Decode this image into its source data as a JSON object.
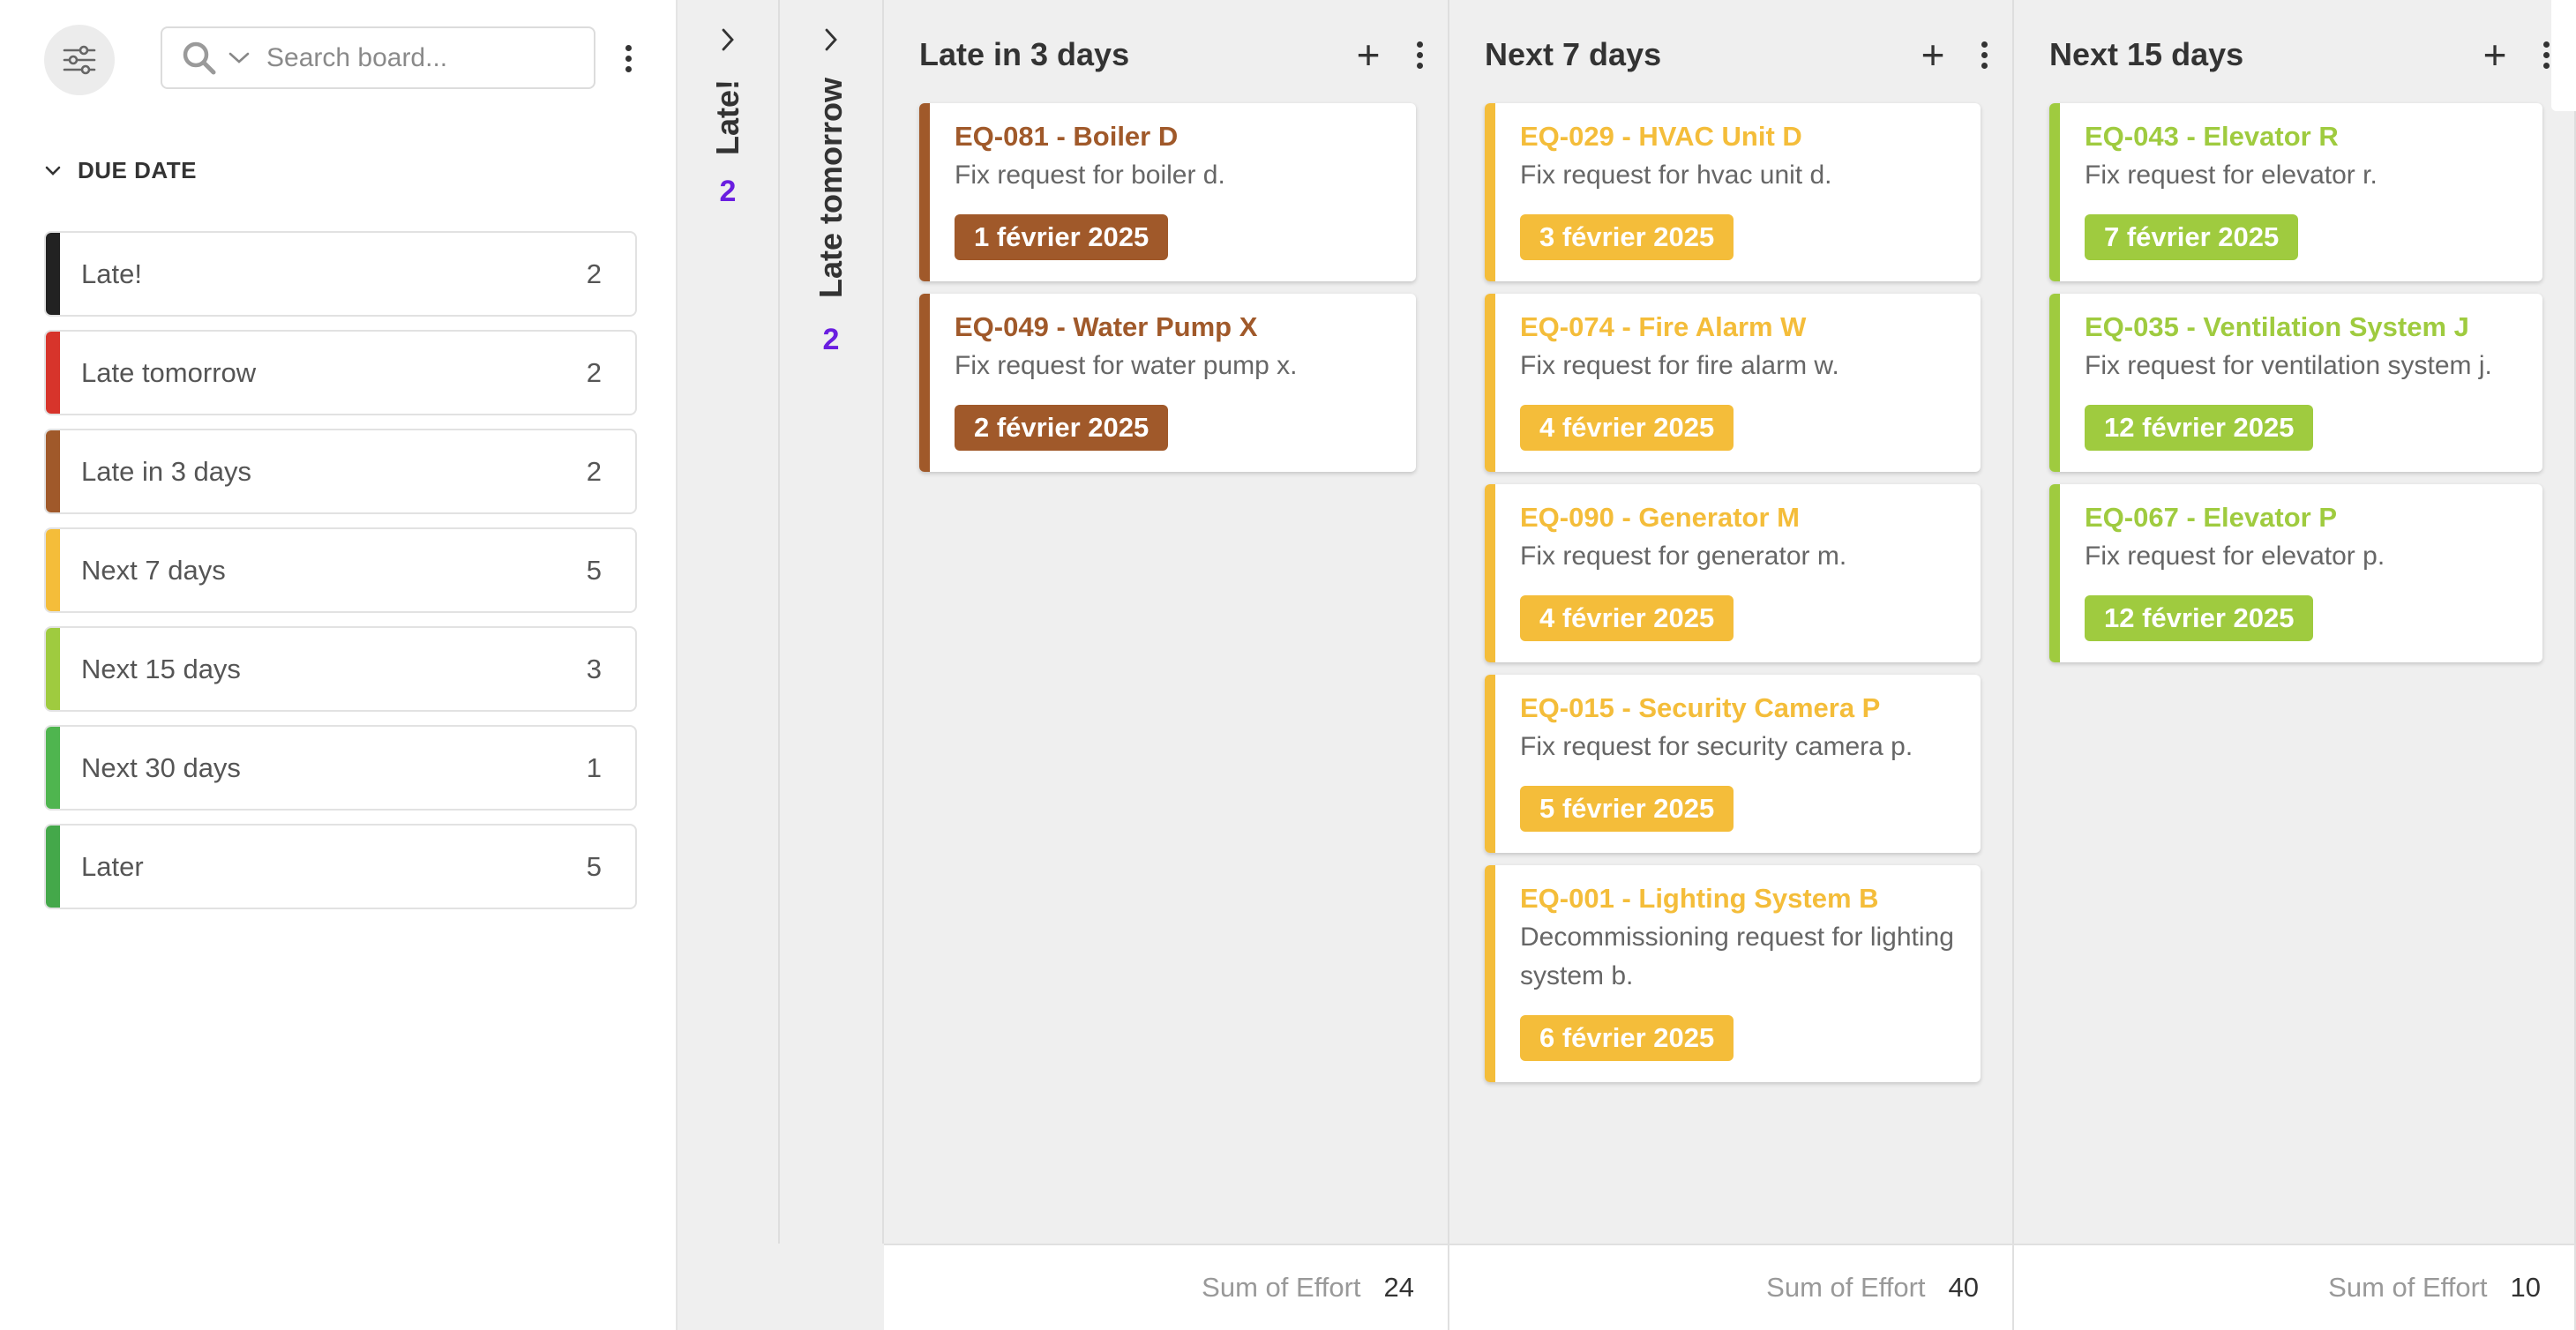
{
  "sidebar": {
    "search_placeholder": "Search board...",
    "section_title": "DUE DATE",
    "groups": [
      {
        "label": "Late!",
        "count": "2",
        "color": "#222222"
      },
      {
        "label": "Late tomorrow",
        "count": "2",
        "color": "#d7342b"
      },
      {
        "label": "Late in 3 days",
        "count": "2",
        "color": "#a0592a"
      },
      {
        "label": "Next 7 days",
        "count": "5",
        "color": "#f4bd3a"
      },
      {
        "label": "Next 15 days",
        "count": "3",
        "color": "#9fcb3f"
      },
      {
        "label": "Next 30 days",
        "count": "1",
        "color": "#4fb54f"
      },
      {
        "label": "Later",
        "count": "5",
        "color": "#44a84a"
      }
    ]
  },
  "board": {
    "folded": [
      {
        "title": "Late!",
        "count": "2"
      },
      {
        "title": "Late tomorrow",
        "count": "2"
      }
    ],
    "columns": [
      {
        "title": "Late in 3 days",
        "color": "#a0592a",
        "sum_label": "Sum of Effort",
        "sum_value": "24",
        "cards": [
          {
            "title": "EQ-081 - Boiler D",
            "desc": "Fix request for boiler d.",
            "date": "1 février 2025"
          },
          {
            "title": "EQ-049 - Water Pump X",
            "desc": "Fix request for water pump x.",
            "date": "2 février 2025"
          }
        ]
      },
      {
        "title": "Next 7 days",
        "color": "#f4bd3a",
        "sum_label": "Sum of Effort",
        "sum_value": "40",
        "cards": [
          {
            "title": "EQ-029 - HVAC Unit D",
            "desc": "Fix request for hvac unit d.",
            "date": "3 février 2025"
          },
          {
            "title": "EQ-074 - Fire Alarm W",
            "desc": "Fix request for fire alarm w.",
            "date": "4 février 2025"
          },
          {
            "title": "EQ-090 - Generator M",
            "desc": "Fix request for generator m.",
            "date": "4 février 2025"
          },
          {
            "title": "EQ-015 - Security Camera P",
            "desc": "Fix request for security camera p.",
            "date": "5 février 2025"
          },
          {
            "title": "EQ-001 - Lighting System B",
            "desc": "Decommissioning request for lighting system b.",
            "date": "6 février 2025"
          }
        ]
      },
      {
        "title": "Next 15 days",
        "color": "#9fcb3f",
        "sum_label": "Sum of Effort",
        "sum_value": "10",
        "cards": [
          {
            "title": "EQ-043 - Elevator R",
            "desc": "Fix request for elevator r.",
            "date": "7 février 2025"
          },
          {
            "title": "EQ-035 - Ventilation System J",
            "desc": "Fix request for ventilation system j.",
            "date": "12 février 2025"
          },
          {
            "title": "EQ-067 - Elevator P",
            "desc": "Fix request for elevator p.",
            "date": "12 février 2025"
          }
        ]
      }
    ]
  }
}
